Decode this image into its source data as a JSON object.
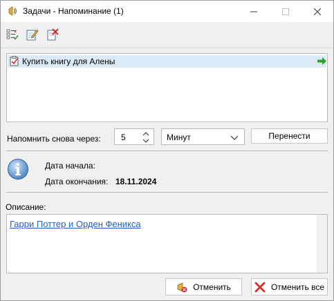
{
  "window": {
    "title": "Задачи - Напоминание (1)"
  },
  "toolbar": {
    "buttons": [
      {
        "name": "checklist-icon"
      },
      {
        "name": "edit-icon"
      },
      {
        "name": "delete-icon"
      }
    ]
  },
  "reminders": {
    "items": [
      {
        "label": "Купить книгу для Алены",
        "icon": "task-checkbox-icon",
        "action_icon": "green-arrow-icon"
      }
    ]
  },
  "snooze": {
    "label": "Напомнить снова через:",
    "value": "5",
    "unit": "Минут",
    "postpone_label": "Перенести"
  },
  "details": {
    "start_label": "Дата начала:",
    "end_label": "Дата окончания:",
    "end_value": "18.11.2024"
  },
  "description": {
    "label": "Описание:",
    "link_text": "Гарри Поттер и Орден Феникса"
  },
  "footer": {
    "cancel_label": "Отменить",
    "cancel_all_label": "Отменить все"
  },
  "colors": {
    "selection": "#dbeaf7",
    "link": "#1f5fbf",
    "accent_red": "#d32f2f",
    "accent_green": "#2e9e2e"
  }
}
